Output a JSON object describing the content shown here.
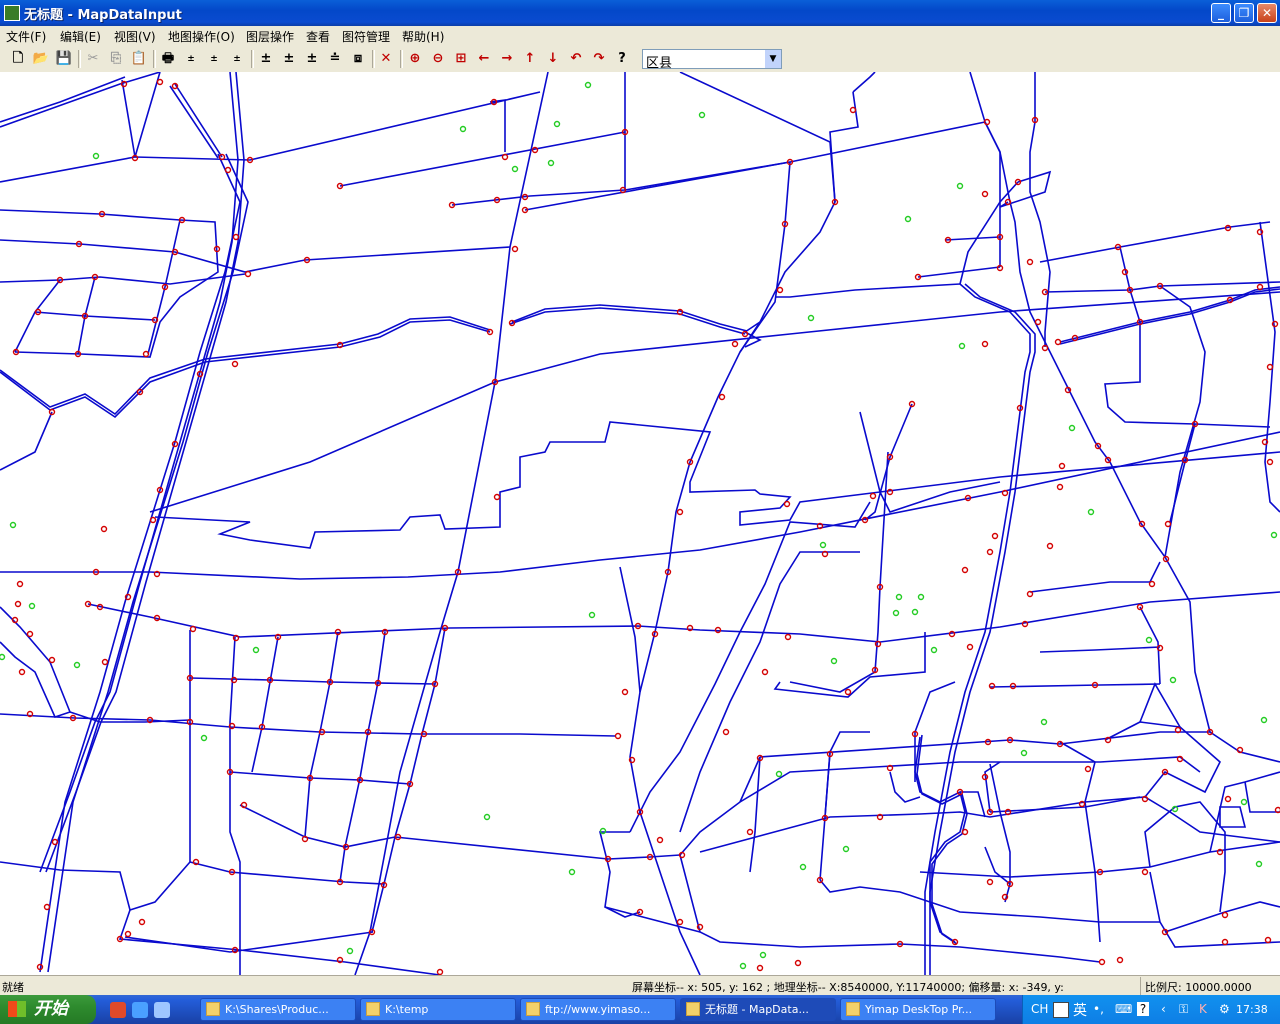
{
  "window": {
    "title": "无标题 - MapDataInput",
    "icon": "map-app-icon"
  },
  "menu": [
    "文件(F)",
    "编辑(E)",
    "视图(V)",
    "地图操作(O)",
    "图层操作",
    "查看",
    "图符管理",
    "帮助(H)"
  ],
  "toolbar": {
    "layer_select_value": "区县",
    "buttons": [
      "new-file",
      "open-folder",
      "save",
      "cut",
      "copy",
      "paste",
      "print",
      "add-point",
      "add-iso",
      "add-line",
      "layer-up",
      "layer-move",
      "layer-down",
      "layer-fill",
      "layer-edit",
      "delete",
      "zoom-in",
      "zoom-out",
      "zoom-extent",
      "pan-left",
      "pan-right",
      "pan-up",
      "pan-down",
      "undo",
      "redo",
      "help"
    ]
  },
  "status": {
    "ready": "就绪",
    "coords": "屏幕坐标-- x: 505, y: 162 ;  地理坐标-- X:8540000, Y:11740000;  偏移量: x: -349, y:",
    "scale": "比例尺: 10000.0000"
  },
  "taskbar": {
    "start_label": "开始",
    "tasks": [
      "K:\\Shares\\Produc...",
      "K:\\temp",
      "ftp://www.yimaso...",
      "无标题 - MapData...",
      "Yimap DeskTop Pr..."
    ],
    "tray": {
      "lang": "CH",
      "ime": "英",
      "time": "17:38"
    }
  },
  "colors": {
    "road": "#0a0acd",
    "node": "#d40000",
    "poi": "#22cc22"
  }
}
